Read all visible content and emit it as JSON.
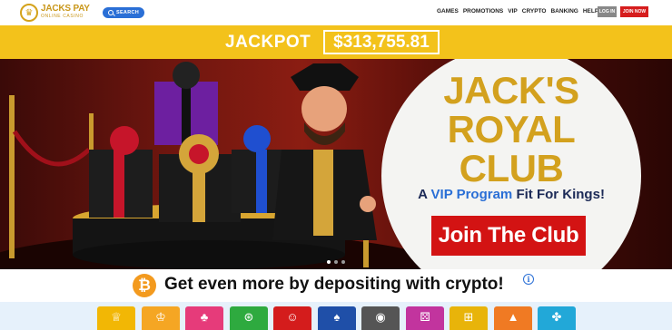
{
  "header": {
    "logo_title": "JACKS PAY",
    "logo_sub": "ONLINE CASINO",
    "logo_glyph": "♛",
    "search_label": "SEARCH",
    "nav": [
      "GAMES",
      "PROMOTIONS",
      "VIP",
      "CRYPTO",
      "BANKING",
      "HELP"
    ],
    "login_label": "LOG IN",
    "join_label": "JOIN NOW"
  },
  "jackpot": {
    "label": "JACKPOT",
    "value": "$313,755.81"
  },
  "hero": {
    "title_line1": "JACK'S",
    "title_line2": "ROYAL",
    "title_line3": "CLUB",
    "tagline_pre": "A ",
    "tagline_vip": "VIP Program",
    "tagline_post": " Fit For Kings!",
    "cta_label": "Join The Club",
    "slide_count": 3,
    "active_slide": 1
  },
  "crypto_banner": {
    "symbol": "₿",
    "text": "Get even more by depositing with crypto!",
    "info": "i"
  },
  "categories": [
    {
      "icon": "crown-icon",
      "glyph": "♕",
      "color": "#f2b705"
    },
    {
      "icon": "crown-stack-icon",
      "glyph": "♔",
      "color": "#f5a623"
    },
    {
      "icon": "cherries-icon",
      "glyph": "♣",
      "color": "#e63b7a"
    },
    {
      "icon": "roulette-icon",
      "glyph": "⊛",
      "color": "#2eaa3f"
    },
    {
      "icon": "dealer-icon",
      "glyph": "☺",
      "color": "#d41c1c"
    },
    {
      "icon": "cards-icon",
      "glyph": "♠",
      "color": "#1f4fa8"
    },
    {
      "icon": "coin-icon",
      "glyph": "◉",
      "color": "#555555"
    },
    {
      "icon": "dice-icon",
      "glyph": "⚄",
      "color": "#c2349e"
    },
    {
      "icon": "basket-icon",
      "glyph": "⊞",
      "color": "#e8b40a"
    },
    {
      "icon": "rocket-icon",
      "glyph": "▲",
      "color": "#f07a23"
    },
    {
      "icon": "puzzle-icon",
      "glyph": "✤",
      "color": "#22a8d8"
    }
  ]
}
